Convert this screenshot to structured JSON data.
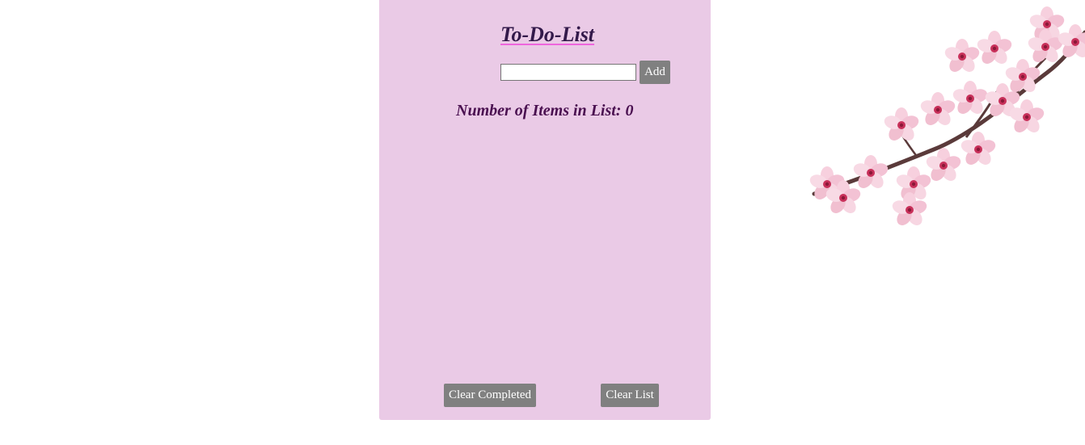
{
  "app": {
    "title": "To-Do-List"
  },
  "input": {
    "value": "",
    "placeholder": ""
  },
  "buttons": {
    "add_label": "Add",
    "clear_completed_label": "Clear Completed",
    "clear_list_label": "Clear List"
  },
  "counter": {
    "label": "Number of Items in List: ",
    "count": "0"
  },
  "items": [],
  "colors": {
    "card_background": "#eacae6",
    "title_text": "#33194a",
    "title_underline": "#ee66dd",
    "counter_text": "#4a1050",
    "button_background": "#808080",
    "button_text": "#ffffff",
    "blossom_petal": "#f5c6d8",
    "blossom_center": "#c8305a",
    "branch": "#5a3a3a"
  },
  "decoration": {
    "image": "cherry-blossom-branch"
  }
}
